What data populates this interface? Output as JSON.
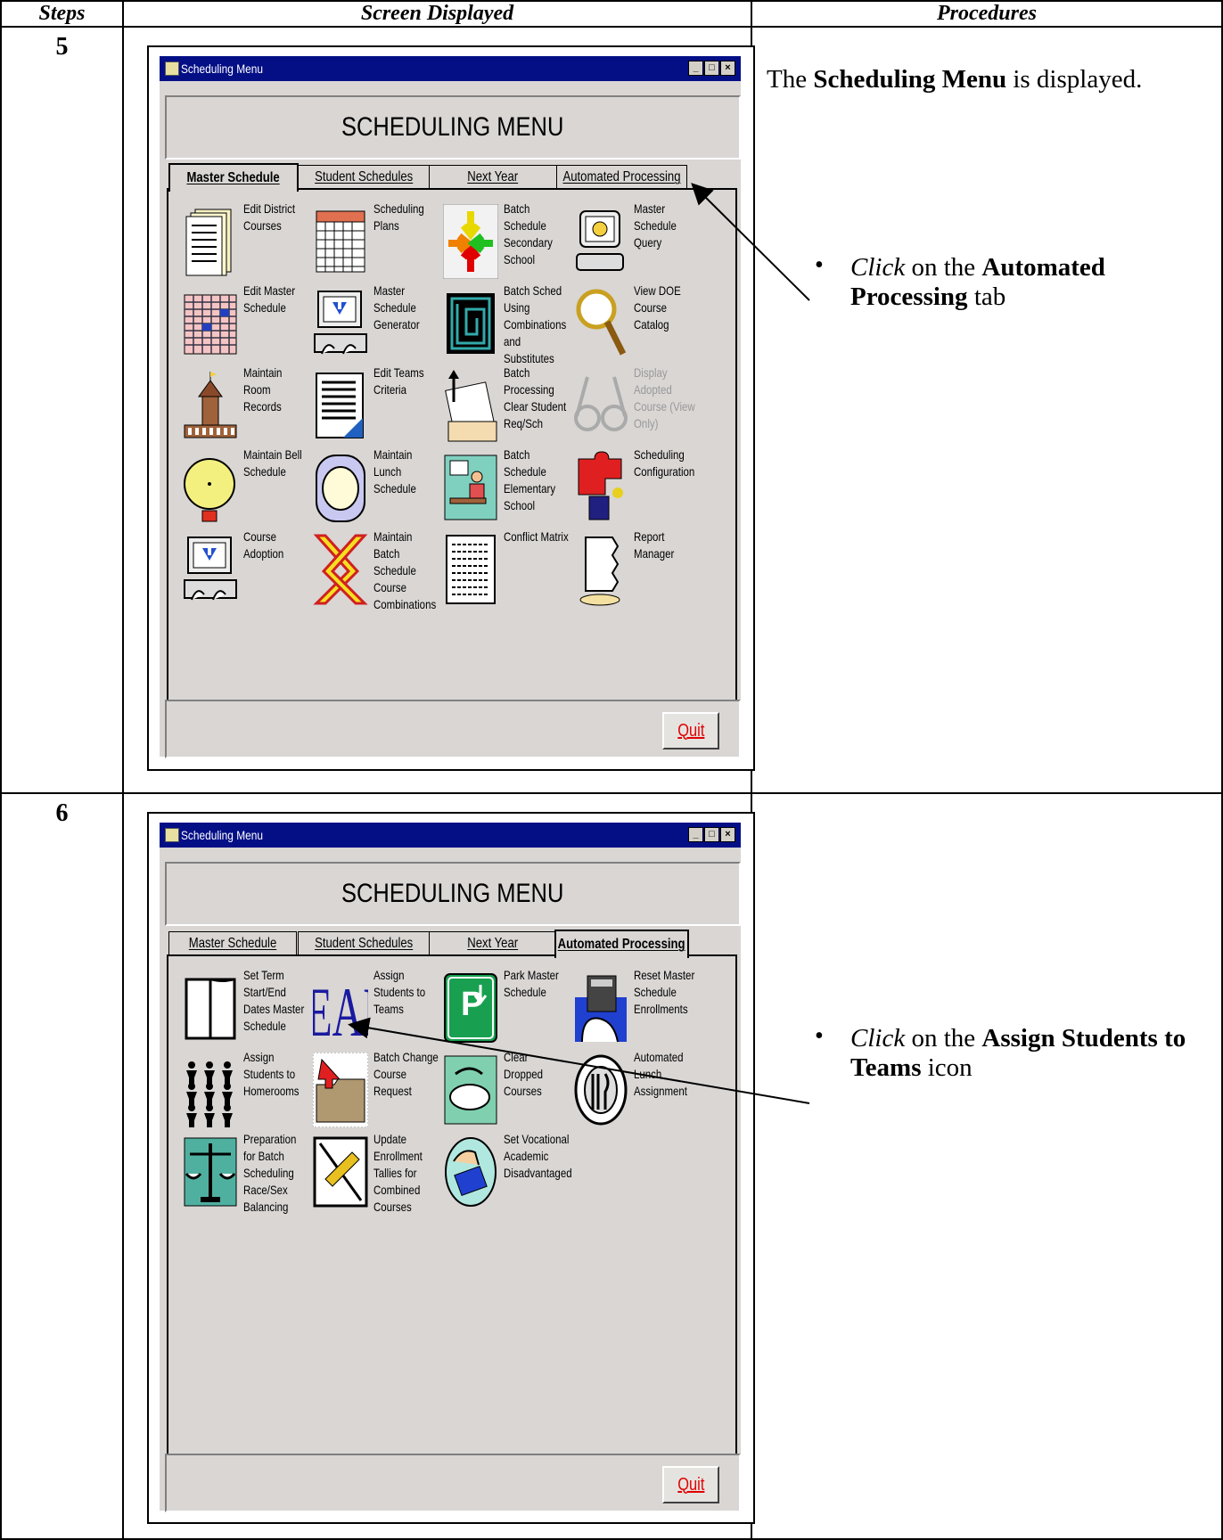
{
  "header": {
    "steps": "Steps",
    "screen": "Screen Displayed",
    "procedures": "Procedures"
  },
  "step5": {
    "number": "5",
    "procedure_lead": {
      "pre": "The ",
      "bold": "Scheduling Menu",
      "post": " is displayed."
    },
    "bullet": {
      "italic": "Click",
      "pre": " on the ",
      "bold": "Automated Processing",
      "post": " tab"
    },
    "window": {
      "title": "Scheduling Menu",
      "banner": "SCHEDULING MENU",
      "tabs": [
        "Master Schedule",
        "Student Schedules",
        "Next Year",
        "Automated Processing"
      ],
      "active_tab": 0,
      "items": [
        {
          "icon": "document-stack-icon",
          "label": "Edit District Courses"
        },
        {
          "icon": "calendar-icon",
          "label": "Scheduling Plans"
        },
        {
          "icon": "converging-arrows-icon",
          "label": "Batch Schedule Secondary School"
        },
        {
          "icon": "computer-query-icon",
          "label": "Master Schedule Query"
        },
        {
          "icon": "spreadsheet-grid-icon",
          "label": "Edit Master Schedule"
        },
        {
          "icon": "computer-keyboard-icon",
          "label": "Master Schedule Generator"
        },
        {
          "icon": "maze-icon",
          "label": "Batch Sched Using Combinations and Substitutes"
        },
        {
          "icon": "magnifier-icon",
          "label": "View DOE Course Catalog"
        },
        {
          "icon": "schoolhouse-icon",
          "label": "Maintain Room Records"
        },
        {
          "icon": "document-pages-icon",
          "label": "Edit Teams Criteria"
        },
        {
          "icon": "paper-clip-icon",
          "label": "Batch Processing Clear Student Req/Sch"
        },
        {
          "icon": "glasses-icon",
          "label": "Display Adopted Course (View Only)",
          "dim": true
        },
        {
          "icon": "bell-icon",
          "label": "Maintain Bell Schedule"
        },
        {
          "icon": "plate-icon",
          "label": "Maintain Lunch Schedule"
        },
        {
          "icon": "student-desk-icon",
          "label": "Batch Schedule Elementary School"
        },
        {
          "icon": "puzzle-icon",
          "label": "Scheduling Configuration"
        },
        {
          "icon": "computer-keyboard-icon",
          "label": "Course Adoption"
        },
        {
          "icon": "crossed-arrows-icon",
          "label": "Maintain Batch Schedule Course Combinations"
        },
        {
          "icon": "report-sheet-icon",
          "label": "Conflict Matrix"
        },
        {
          "icon": "paper-stack-icon",
          "label": "Report Manager"
        }
      ],
      "quit": "Quit"
    }
  },
  "step6": {
    "number": "6",
    "bullet": {
      "italic": "Click",
      "pre": " on the ",
      "bold": "Assign Students to Teams",
      "post": " icon"
    },
    "window": {
      "title": "Scheduling Menu",
      "banner": "SCHEDULING MENU",
      "tabs": [
        "Master Schedule",
        "Student Schedules",
        "Next Year",
        "Automated Processing"
      ],
      "active_tab": 3,
      "items": [
        {
          "icon": "open-book-icon",
          "label": "Set Term Start/End Dates Master Schedule"
        },
        {
          "icon": "team-text-icon",
          "label": "Assign Students to Teams"
        },
        {
          "icon": "parking-sign-icon",
          "label": "Park Master Schedule"
        },
        {
          "icon": "hand-calculator-icon",
          "label": "Reset Master Schedule Enrollments"
        },
        {
          "icon": "people-group-icon",
          "label": "Assign Students to Homerooms"
        },
        {
          "icon": "folder-arrow-icon",
          "label": "Batch Change Course Request"
        },
        {
          "icon": "trash-bin-icon",
          "label": "Clear Dropped Courses"
        },
        {
          "icon": "plate-fork-knife-icon",
          "label": "Automated Lunch Assignment"
        },
        {
          "icon": "scales-icon",
          "label": "Preparation for Batch Scheduling Race/Sex Balancing"
        },
        {
          "icon": "pencil-icon",
          "label": "Update Enrollment Tallies for Combined Courses"
        },
        {
          "icon": "hand-book-icon",
          "label": "Set Vocational Academic Disadvantaged"
        }
      ],
      "team_text": "TEAM",
      "quit": "Quit"
    }
  }
}
